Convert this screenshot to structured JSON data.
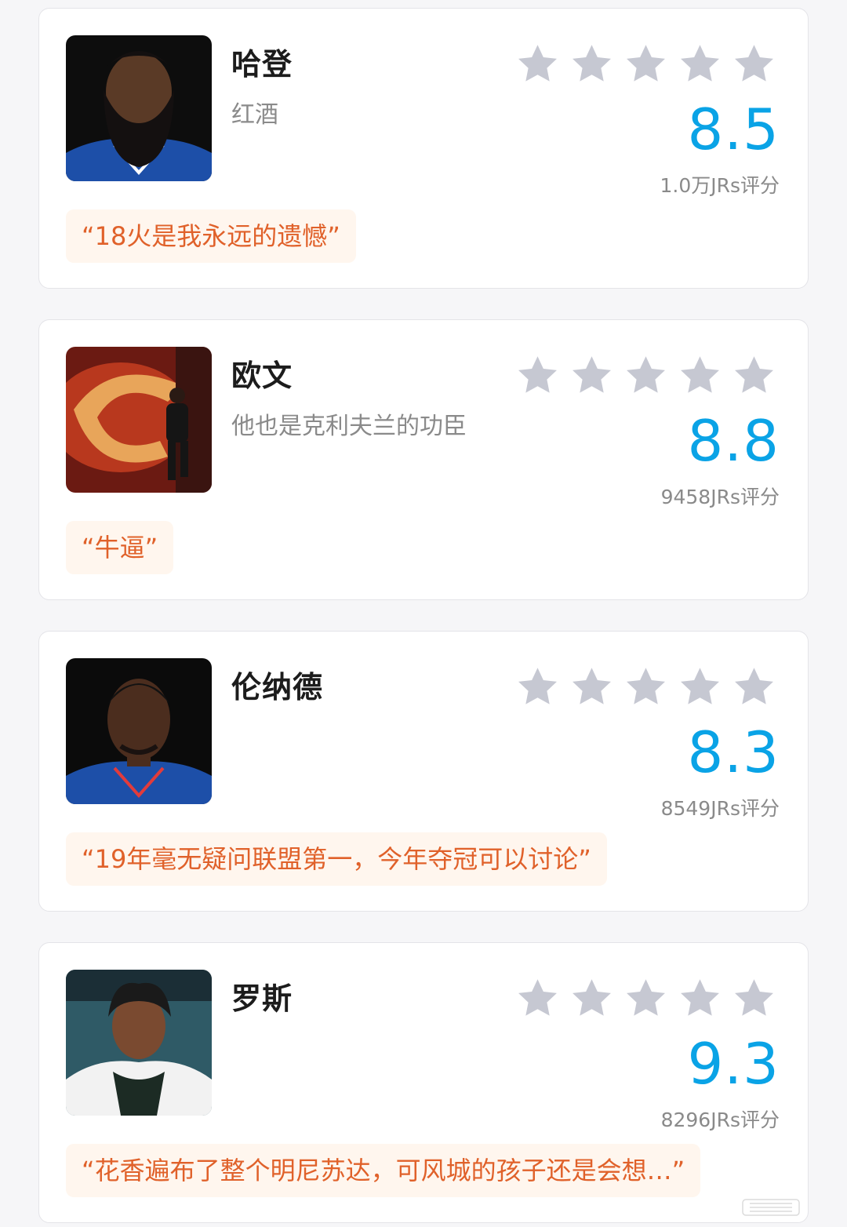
{
  "accent": {
    "score": "#0aa3e6",
    "quote_text": "#e0612a",
    "quote_bg": "#fff6ee",
    "star": "#c6c8d2"
  },
  "cards": [
    {
      "name": "哈登",
      "subtitle": "红酒",
      "score": "8.5",
      "count": "1.0万JRs评分",
      "quote": "“18火是我永远的遗憾”",
      "stars": 5
    },
    {
      "name": "欧文",
      "subtitle": "他也是克利夫兰的功臣",
      "score": "8.8",
      "count": "9458JRs评分",
      "quote": "“牛逼”",
      "stars": 5
    },
    {
      "name": "伦纳德",
      "subtitle": "",
      "score": "8.3",
      "count": "8549JRs评分",
      "quote": "“19年毫无疑问联盟第一，今年夺冠可以讨论”",
      "stars": 5
    },
    {
      "name": "罗斯",
      "subtitle": "",
      "score": "9.3",
      "count": "8296JRs评分",
      "quote": "“花香遍布了整个明尼苏达，可风城的孩子还是会想…”",
      "stars": 5
    }
  ]
}
